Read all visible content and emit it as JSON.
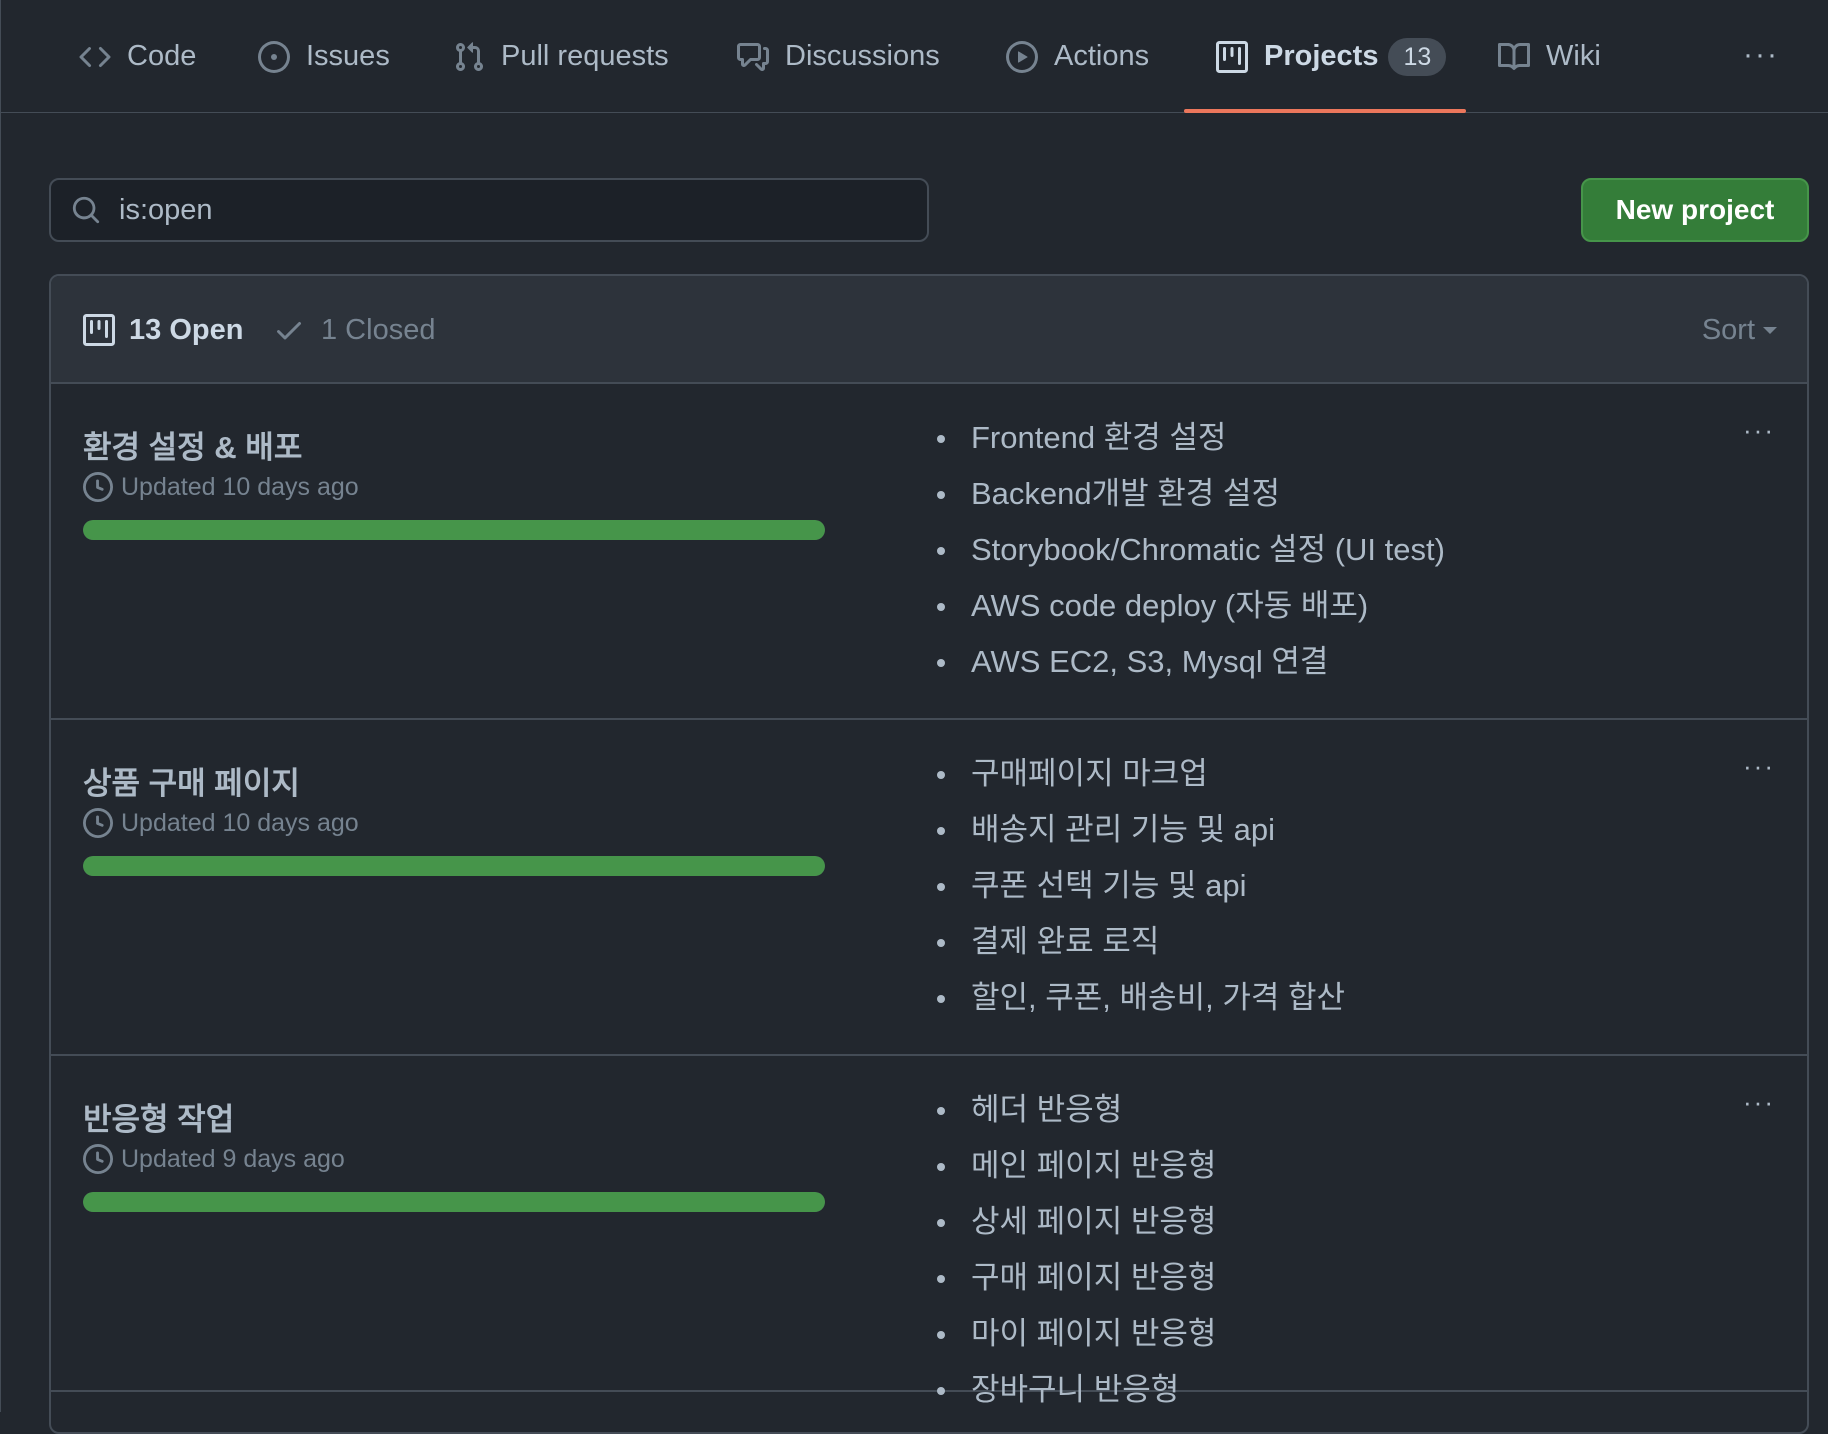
{
  "nav": {
    "tabs": [
      {
        "label": "Code",
        "icon": "code-icon"
      },
      {
        "label": "Issues",
        "icon": "issue-opened-icon"
      },
      {
        "label": "Pull requests",
        "icon": "git-pull-request-icon"
      },
      {
        "label": "Discussions",
        "icon": "comment-discussion-icon"
      },
      {
        "label": "Actions",
        "icon": "play-icon"
      },
      {
        "label": "Projects",
        "icon": "project-icon",
        "counter": "13",
        "active": true
      },
      {
        "label": "Wiki",
        "icon": "book-icon"
      }
    ],
    "more": "···"
  },
  "search": {
    "value": "is:open",
    "placeholder": "is:open"
  },
  "new_project": {
    "label": "New project",
    "color": "#347d39"
  },
  "list_header": {
    "open_label": "13 Open",
    "closed_label": "1 Closed",
    "sort_label": "Sort"
  },
  "projects": [
    {
      "title": "환경 설정 & 배포",
      "updated": "Updated 10 days ago",
      "progress": 1.0,
      "items": [
        "Frontend 환경 설정",
        "Backend개발 환경 설정",
        "Storybook/Chromatic 설정 (UI test)",
        "AWS code deploy (자동 배포)",
        "AWS EC2, S3, Mysql 연결"
      ]
    },
    {
      "title": "상품 구매 페이지",
      "updated": "Updated 10 days ago",
      "progress": 1.0,
      "items": [
        "구매페이지 마크업",
        "배송지 관리 기능 및 api",
        "쿠폰 선택 기능 및 api",
        "결제 완료 로직",
        "할인, 쿠폰, 배송비, 가격 합산"
      ]
    },
    {
      "title": "반응형 작업",
      "updated": "Updated 9 days ago",
      "progress": 1.0,
      "items": [
        "헤더 반응형",
        "메인 페이지 반응형",
        "상세 페이지 반응형",
        "구매 페이지 반응형",
        "마이 페이지 반응형",
        "장바구니 반응형"
      ]
    }
  ],
  "colors": {
    "background": "#22272e",
    "header_bg": "#2d333b",
    "accent_underline": "#ec775c",
    "progress_fill": "#46954a",
    "button_green": "#347d39"
  }
}
